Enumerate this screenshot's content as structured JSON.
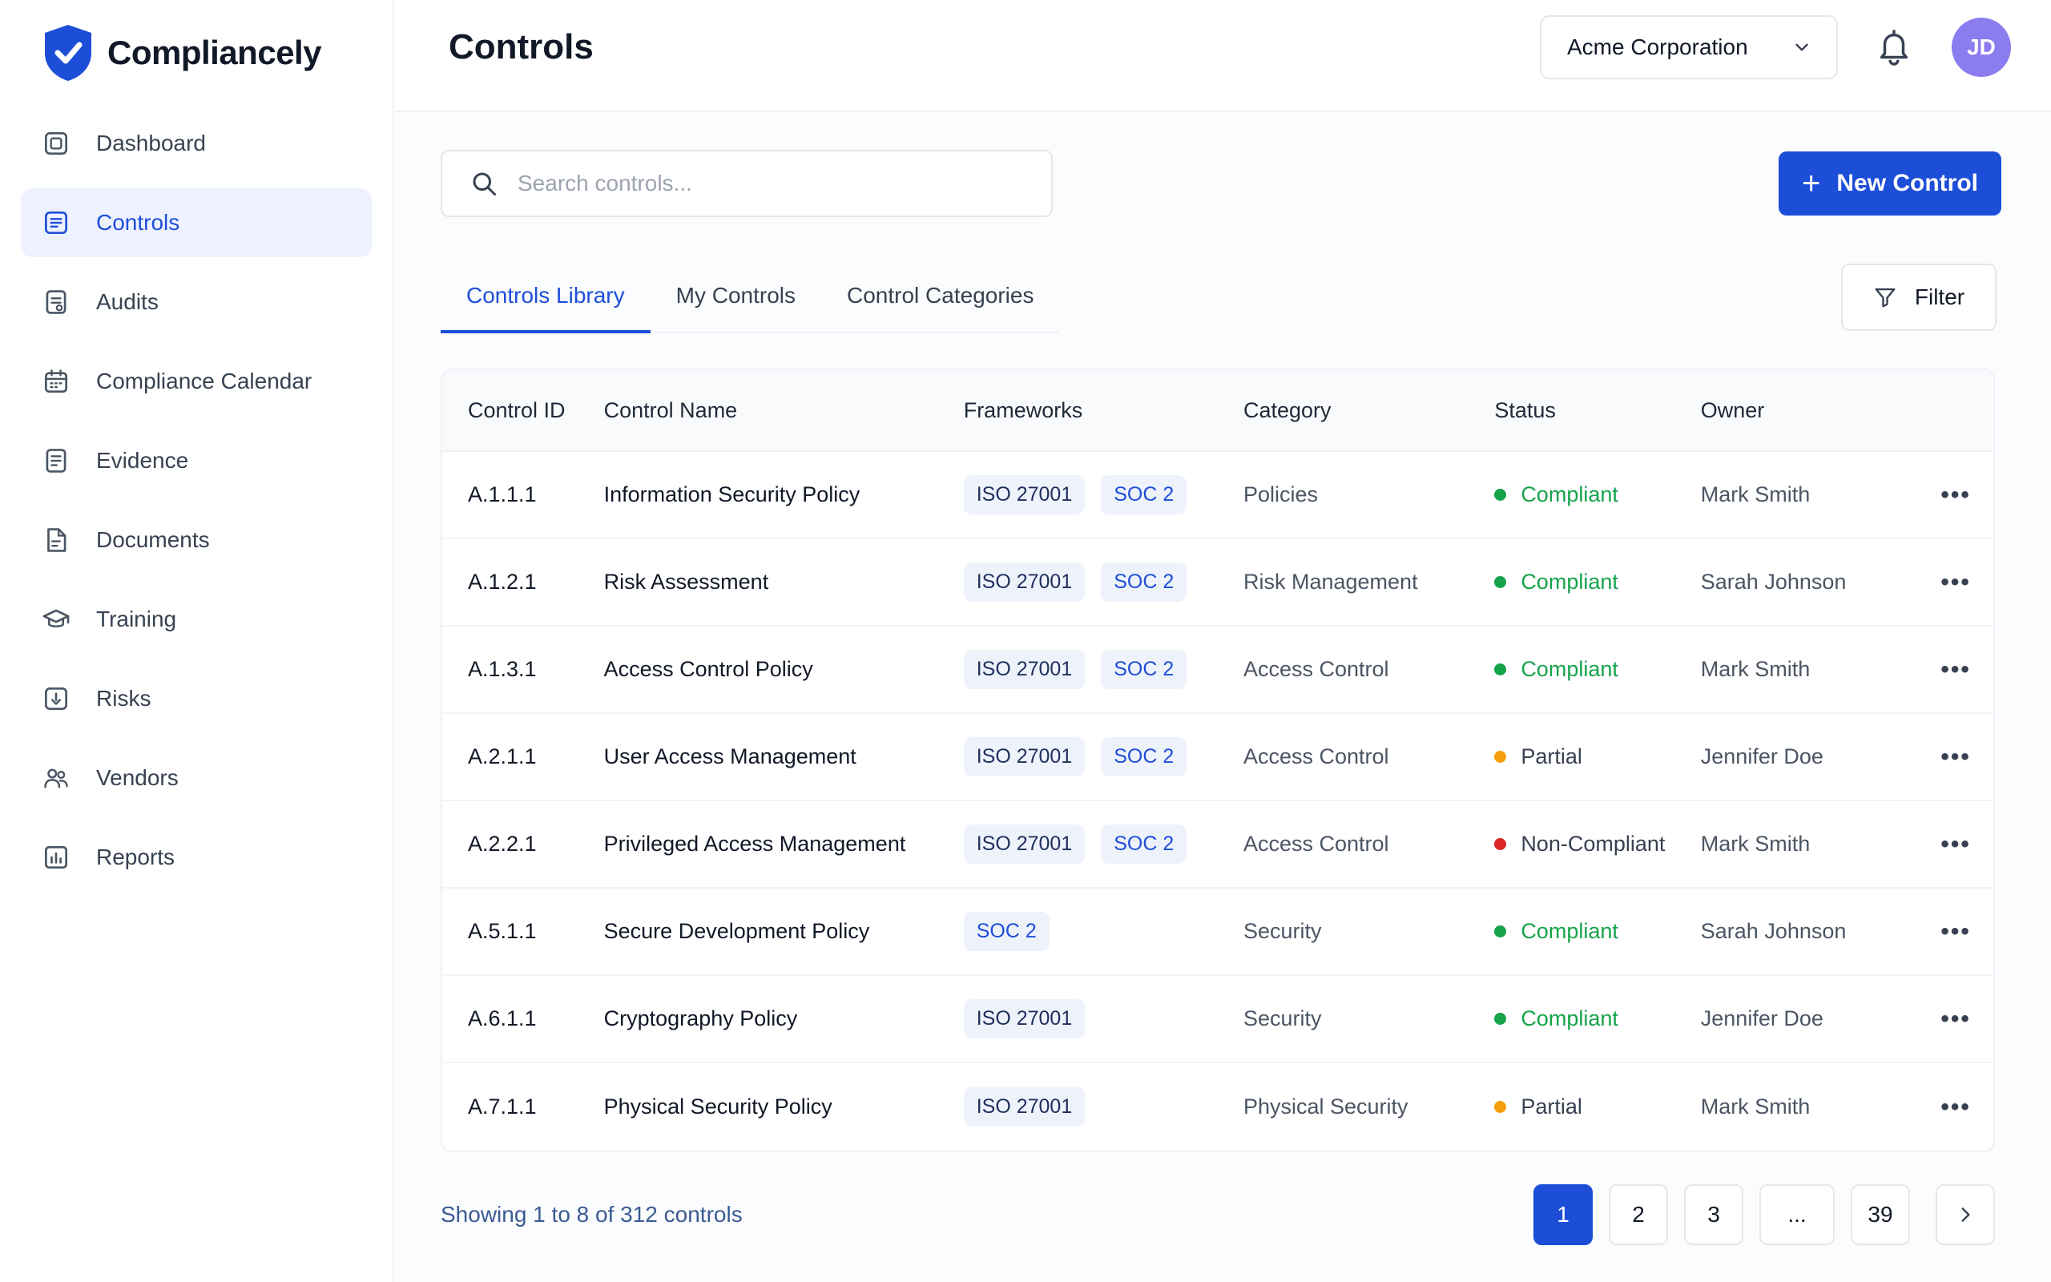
{
  "brand": {
    "name": "Compliancely"
  },
  "sidebar": {
    "items": [
      {
        "label": "Dashboard",
        "icon": "dashboard-icon"
      },
      {
        "label": "Controls",
        "icon": "controls-icon",
        "active": true
      },
      {
        "label": "Audits",
        "icon": "audits-icon"
      },
      {
        "label": "Compliance Calendar",
        "icon": "calendar-icon"
      },
      {
        "label": "Evidence",
        "icon": "evidence-icon"
      },
      {
        "label": "Documents",
        "icon": "documents-icon"
      },
      {
        "label": "Training",
        "icon": "training-icon"
      },
      {
        "label": "Risks",
        "icon": "risks-icon"
      },
      {
        "label": "Vendors",
        "icon": "vendors-icon"
      },
      {
        "label": "Reports",
        "icon": "reports-icon"
      }
    ]
  },
  "header": {
    "title": "Controls",
    "org_selector": "Acme Corporation",
    "avatar_initials": "JD"
  },
  "search": {
    "placeholder": "Search controls..."
  },
  "actions": {
    "new_control": "New Control",
    "filter": "Filter"
  },
  "tabs": [
    {
      "label": "Controls Library",
      "active": true
    },
    {
      "label": "My Controls"
    },
    {
      "label": "Control Categories"
    }
  ],
  "table": {
    "columns": [
      "Control ID",
      "Control Name",
      "Frameworks",
      "Category",
      "Status",
      "Owner"
    ],
    "rows": [
      {
        "id": "A.1.1.1",
        "name": "Information Security Policy",
        "frameworks": [
          "ISO 27001",
          "SOC 2"
        ],
        "category": "Policies",
        "status": "Compliant",
        "owner": "Mark Smith"
      },
      {
        "id": "A.1.2.1",
        "name": "Risk Assessment",
        "frameworks": [
          "ISO 27001",
          "SOC 2"
        ],
        "category": "Risk Management",
        "status": "Compliant",
        "owner": "Sarah Johnson"
      },
      {
        "id": "A.1.3.1",
        "name": "Access Control Policy",
        "frameworks": [
          "ISO 27001",
          "SOC 2"
        ],
        "category": "Access Control",
        "status": "Compliant",
        "owner": "Mark Smith"
      },
      {
        "id": "A.2.1.1",
        "name": "User Access Management",
        "frameworks": [
          "ISO 27001",
          "SOC 2"
        ],
        "category": "Access Control",
        "status": "Partial",
        "owner": "Jennifer Doe"
      },
      {
        "id": "A.2.2.1",
        "name": "Privileged Access Management",
        "frameworks": [
          "ISO 27001",
          "SOC 2"
        ],
        "category": "Access Control",
        "status": "Non-Compliant",
        "owner": "Mark Smith"
      },
      {
        "id": "A.5.1.1",
        "name": "Secure Development Policy",
        "frameworks": [
          "SOC 2"
        ],
        "category": "Security",
        "status": "Compliant",
        "owner": "Sarah Johnson"
      },
      {
        "id": "A.6.1.1",
        "name": "Cryptography Policy",
        "frameworks": [
          "ISO 27001"
        ],
        "category": "Security",
        "status": "Compliant",
        "owner": "Jennifer Doe"
      },
      {
        "id": "A.7.1.1",
        "name": "Physical Security Policy",
        "frameworks": [
          "ISO 27001"
        ],
        "category": "Physical Security",
        "status": "Partial",
        "owner": "Mark Smith"
      }
    ],
    "row_action_label": "•••"
  },
  "status_colors": {
    "Compliant": "#16a34a",
    "Partial": "#f59e0b",
    "Non-Compliant": "#dc2626"
  },
  "status_text_colors": {
    "Compliant": "#16a34a",
    "Partial": "#374151",
    "Non-Compliant": "#374151"
  },
  "footer": {
    "showing": "Showing 1 to 8 of 312 controls",
    "pages": [
      "1",
      "2",
      "3",
      "...",
      "39"
    ],
    "current_page": "1"
  },
  "colors": {
    "accent": "#1d4ed8",
    "avatar": "#8b7cf0"
  }
}
